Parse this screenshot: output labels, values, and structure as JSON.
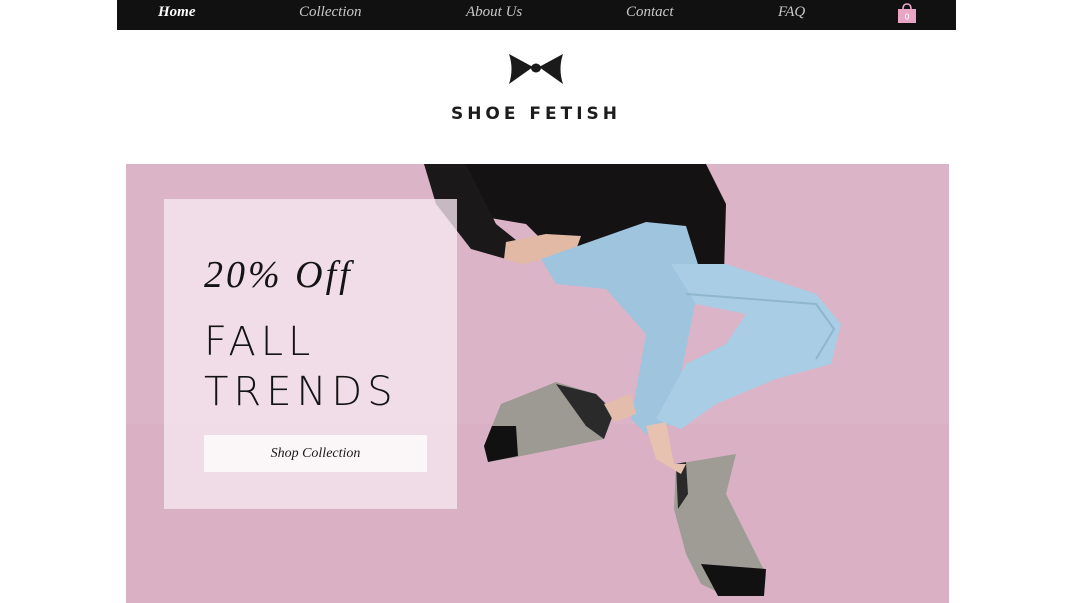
{
  "nav": {
    "items": [
      {
        "label": "Home",
        "active": true
      },
      {
        "label": "Collection",
        "active": false
      },
      {
        "label": "About Us",
        "active": false
      },
      {
        "label": "Contact",
        "active": false
      },
      {
        "label": "FAQ",
        "active": false
      }
    ],
    "cart_icon": "shopping-bag-icon",
    "cart_count": "0"
  },
  "brand": {
    "logo_icon": "bow-icon",
    "name": "SHOE FETISH"
  },
  "hero": {
    "discount": "20% Off",
    "title_line1": "FALL",
    "title_line2": "TRENDS",
    "button_label": "Shop Collection"
  },
  "colors": {
    "nav_bg": "#111111",
    "hero_bg": "#dbb4c7",
    "promo_box": "#f6e8f0",
    "cart_pink": "#e8a6c4"
  }
}
